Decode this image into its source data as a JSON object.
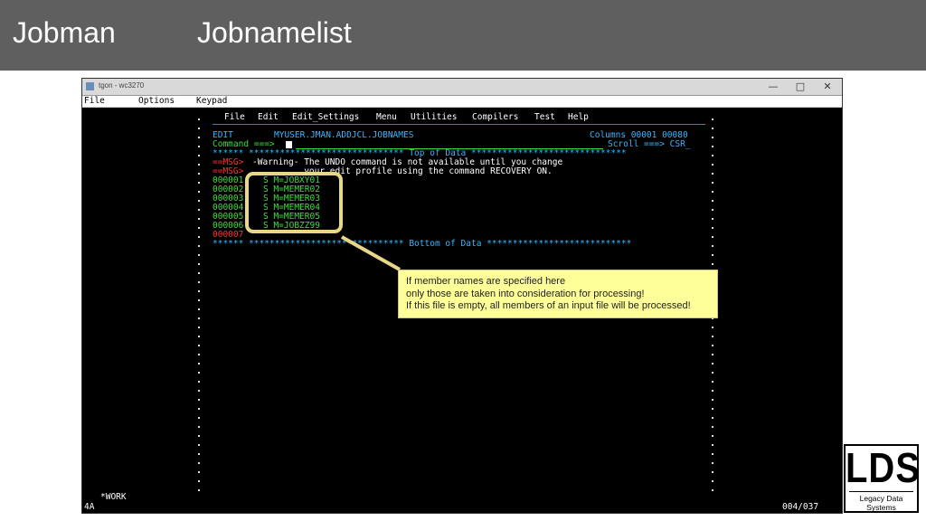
{
  "slide": {
    "title": "Jobman",
    "subtitle": "Jobnamelist"
  },
  "window": {
    "title": "tgon - wc3270",
    "controls": {
      "minimize": "—",
      "maximize": "□",
      "close": "✕"
    },
    "menu": [
      "File",
      "Options",
      "Keypad"
    ]
  },
  "ispf": {
    "action_bar": [
      "File",
      "Edit",
      "Edit_Settings",
      "Menu",
      "Utilities",
      "Compilers",
      "Test",
      "Help"
    ],
    "mode": "EDIT",
    "dataset": "MYUSER.JMAN.ADDJCL.JOBNAMES",
    "columns_label": "Columns 00001 00080",
    "command_label": "Command ===>",
    "scroll_label": "Scroll ===> CSR_",
    "top_of_data": "****** ****************************** Top of Data ******************************",
    "msg_prefix": "==MSG>",
    "msg1": "-Warning- The UNDO command is not available until you change",
    "msg2": "          your edit profile using the command RECOVERY ON.",
    "lines": [
      {
        "num": "000001",
        "text": "S M=JOBXY01"
      },
      {
        "num": "000002",
        "text": "S M=MEMER02"
      },
      {
        "num": "000003",
        "text": "S M=MEMER03"
      },
      {
        "num": "000004",
        "text": "S M=MEMER04"
      },
      {
        "num": "000005",
        "text": "S M=MEMER05"
      },
      {
        "num": "000006",
        "text": "S M=JOBZZ99"
      }
    ],
    "empty_line_num": "000007",
    "bottom_of_data": "****** ****************************** Bottom of Data ****************************",
    "workspace": "*WORK",
    "oia_left": "4A",
    "cursor_pos": "004/037"
  },
  "callout": {
    "line1": "If member names are specified here",
    "line2": "only those are taken into consideration for processing!",
    "line3": "If this file is empty, all members of an input file will be processed!"
  },
  "logo": {
    "main": "LDS",
    "sub": "Legacy Data Systems"
  },
  "colors": {
    "header_bg": "#5f5f5f",
    "callout_bg": "#ffff99",
    "terminal_green": "#3ddc3d",
    "terminal_cyan": "#37b6ff",
    "terminal_red": "#ff3030"
  }
}
